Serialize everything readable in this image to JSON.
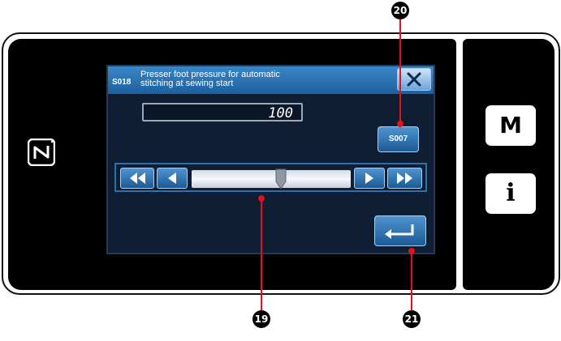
{
  "dialog": {
    "code": "S018",
    "title": "Presser foot pressure for automatic\nstitching at sewing start",
    "value": "100",
    "link_button": "S007"
  },
  "slider": {
    "level_fraction": 0.56
  },
  "side_buttons": {
    "menu": "M",
    "info": "i"
  },
  "callouts": {
    "slider": "19",
    "link_button": "20",
    "enter": "21"
  },
  "colors": {
    "callout": "#e0141a",
    "titlebar": "#2c76b6",
    "dialog_bg": "#0f1e33"
  }
}
